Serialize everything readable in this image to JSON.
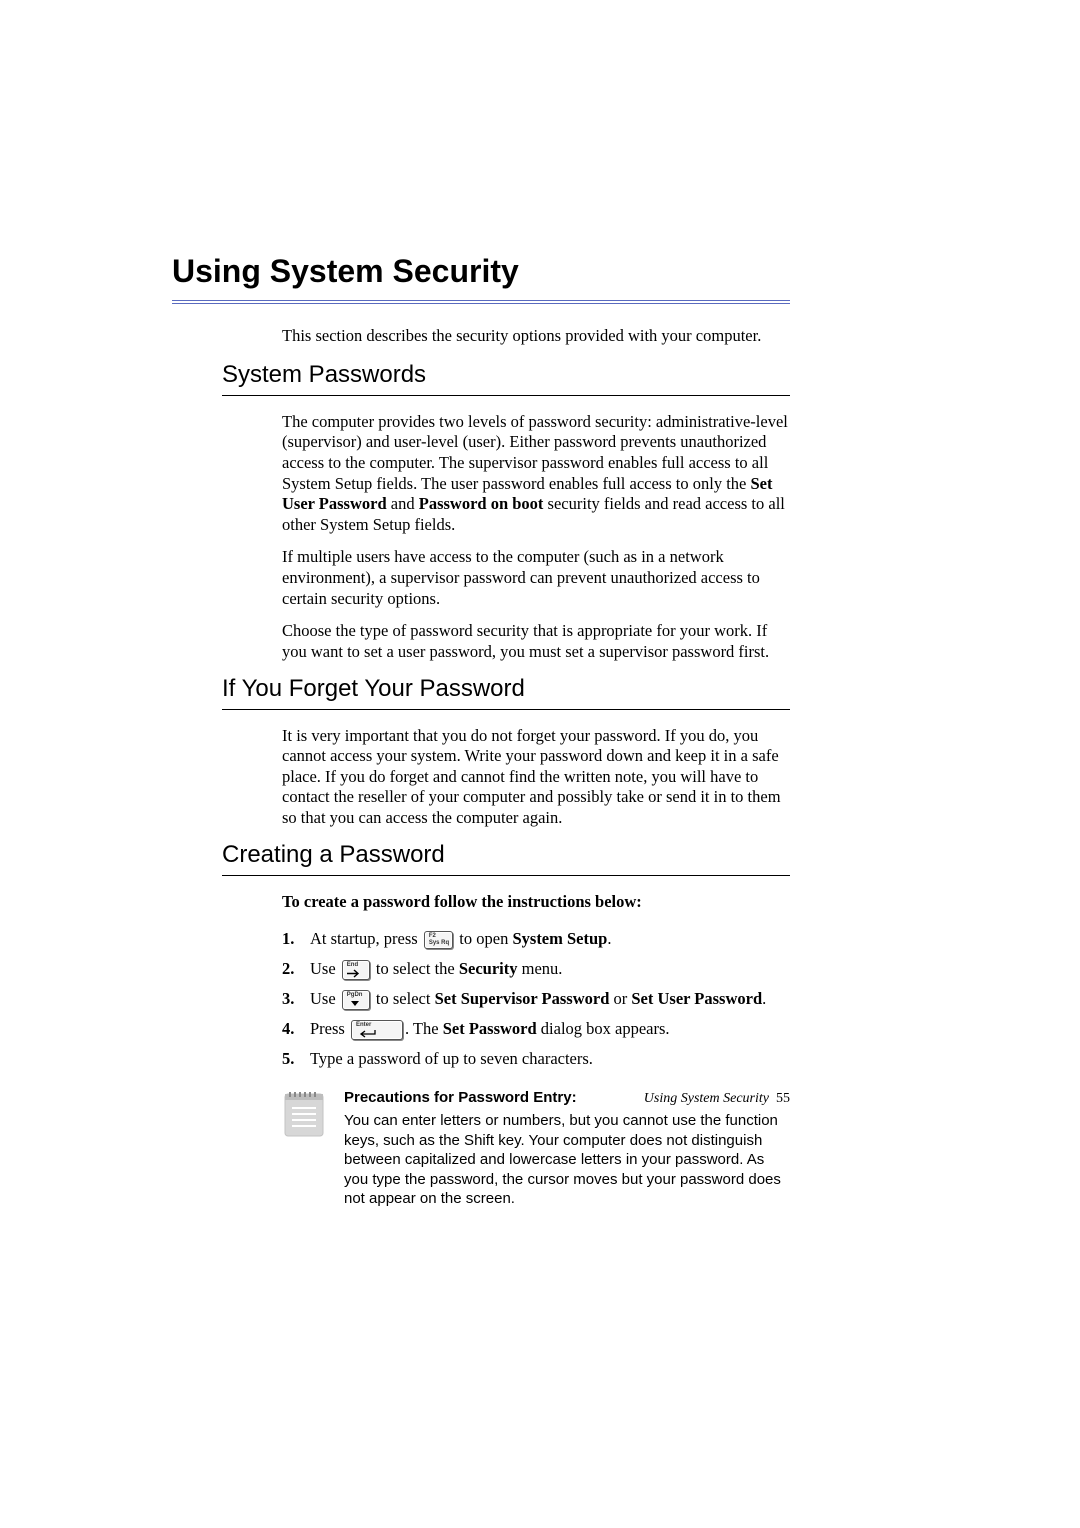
{
  "title": "Using System Security",
  "intro": "This section describes the security options provided with your computer.",
  "sections": {
    "s1": {
      "heading": "System Passwords",
      "p1a": "The computer provides two levels of password security: administrative-level (supervisor) and user-level (user). Either password prevents unauthorized access to the computer. The supervisor password enables full access to all System Setup fields. The user password enables full access to only the ",
      "p1b": "Set User Password",
      "p1c": " and ",
      "p1d": "Password on boot",
      "p1e": " security fields and read access to all other System Setup fields.",
      "p2": "If multiple users have access to the computer (such as in a network environment), a supervisor password can prevent unauthorized access to certain security options.",
      "p3": "Choose the type of password security that is appropriate for your work. If you want to set a user password, you must set a supervisor password first."
    },
    "s2": {
      "heading": "If You Forget Your Password",
      "p1": "It is very important that you do not forget your password. If you do, you cannot access your system. Write your password down and keep it in a safe place. If you do forget and cannot find the written note, you will have to contact the reseller of your computer and possibly take or send it in to them so that you can access the computer again."
    },
    "s3": {
      "heading": "Creating a Password",
      "lead": "To create a password follow the instructions below:",
      "steps": {
        "st1a": "At startup, press ",
        "st1b": " to open ",
        "st1c": "System Setup",
        "st1d": ".",
        "st2a": "Use ",
        "st2b": " to select the ",
        "st2c": "Security",
        "st2d": " menu.",
        "st3a": "Use ",
        "st3b": " to select ",
        "st3c": "Set Supervisor Password",
        "st3d": " or ",
        "st3e": "Set User Password",
        "st3f": ".",
        "st4a": "Press ",
        "st4b": ". The ",
        "st4c": "Set Password",
        "st4d": " dialog box appears.",
        "st5": "Type a password of up to seven characters."
      },
      "keys": {
        "k1": "F2",
        "k1s": "Sys Rq",
        "k2": "End",
        "k3": "PgDn",
        "k4": "Enter"
      },
      "note": {
        "heading": "Precautions for Password Entry:",
        "body": "You can enter letters or numbers, but you cannot use the function keys, such as the Shift key. Your computer does not distinguish between capitalized and lowercase letters in your password. As you type the password, the cursor moves but your password does not appear on the screen."
      }
    }
  },
  "footer": {
    "label": "Using System Security",
    "page": "55"
  }
}
